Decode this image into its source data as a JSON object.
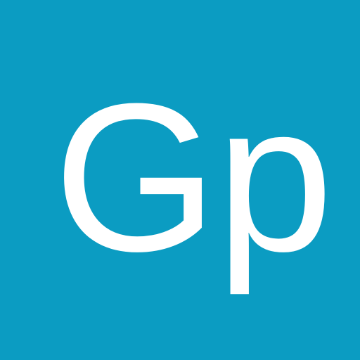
{
  "app_icon": {
    "glyph_text": "Gp",
    "colors": {
      "background": "#0b9cc2",
      "glyph": "#ffffff"
    }
  }
}
